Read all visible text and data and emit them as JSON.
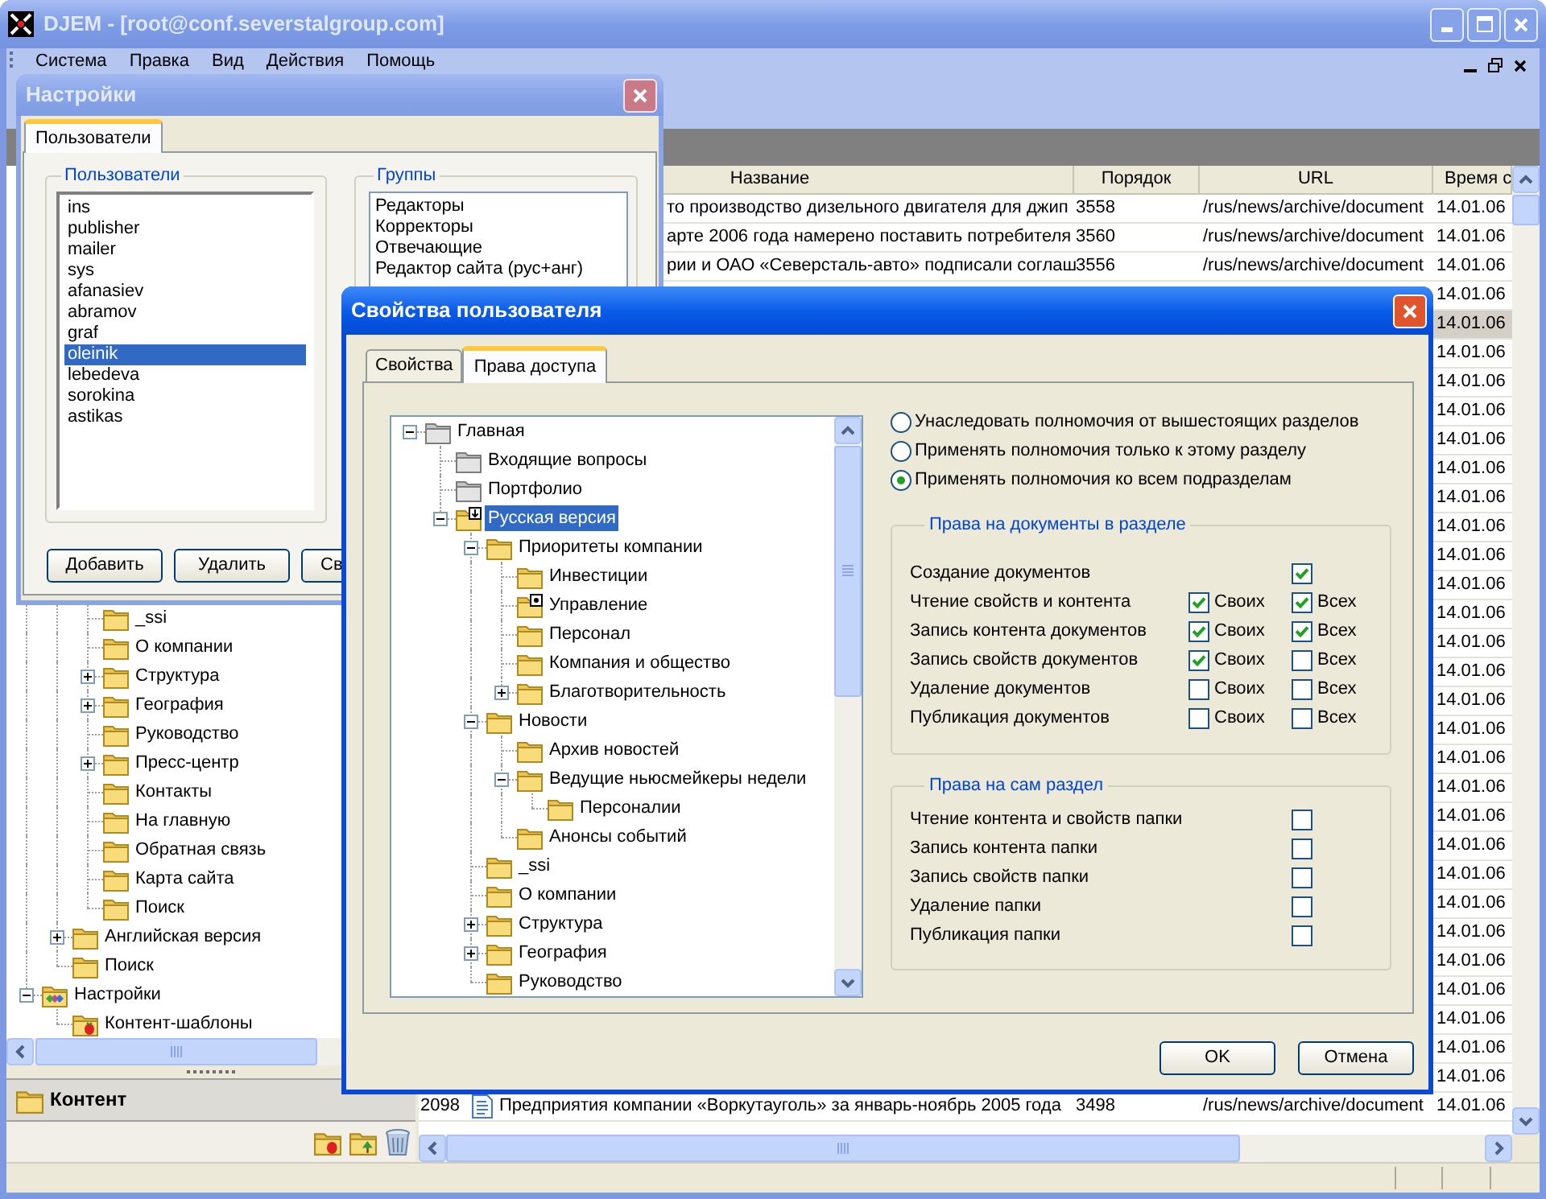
{
  "main_window": {
    "title": "DJEM - [root@conf.severstalgroup.com]",
    "menu": [
      "Система",
      "Правка",
      "Вид",
      "Действия",
      "Помощь"
    ]
  },
  "settings_dialog": {
    "title": "Настройки",
    "tabs": [
      {
        "label": "Пользователи",
        "selected": true
      }
    ],
    "users": {
      "title": "Пользователи",
      "items": [
        {
          "label": "ins",
          "selected": false
        },
        {
          "label": "publisher",
          "selected": false
        },
        {
          "label": "mailer",
          "selected": false
        },
        {
          "label": "sys",
          "selected": false
        },
        {
          "label": "afanasiev",
          "selected": false
        },
        {
          "label": "abramov",
          "selected": false
        },
        {
          "label": "graf",
          "selected": false
        },
        {
          "label": "oleinik",
          "selected": true
        },
        {
          "label": "lebedeva",
          "selected": false
        },
        {
          "label": "sorokina",
          "selected": false
        },
        {
          "label": "astikas",
          "selected": false
        }
      ]
    },
    "groups": {
      "title": "Группы",
      "items": [
        {
          "label": "Редакторы",
          "selected": false
        },
        {
          "label": "Корректоры",
          "selected": false
        },
        {
          "label": "Отвечающие",
          "selected": false
        },
        {
          "label": "Редактор сайта (рус+анг)",
          "selected": false
        }
      ]
    },
    "buttons": [
      "Добавить",
      "Удалить",
      "Св"
    ]
  },
  "left_panel": {
    "tree": [
      {
        "children": [
          {
            "children": [
              {
                "label": "_ssi",
                "kind": "plain",
                "selected": false
              },
              {
                "label": "О компании",
                "kind": "plain",
                "selected": false
              },
              {
                "label": "Структура",
                "kind": "plain",
                "expanded": false,
                "selected": false
              },
              {
                "label": "География",
                "kind": "plain",
                "expanded": false,
                "selected": false
              },
              {
                "label": "Руководство",
                "kind": "plain",
                "selected": false
              },
              {
                "label": "Пресс-центр",
                "kind": "plain",
                "expanded": false,
                "selected": false
              },
              {
                "label": "Контакты",
                "kind": "plain",
                "selected": false
              },
              {
                "label": "На главную",
                "kind": "plain",
                "selected": false
              },
              {
                "label": "Обратная связь",
                "kind": "plain",
                "selected": false
              },
              {
                "label": "Карта сайта",
                "kind": "plain",
                "selected": false
              },
              {
                "label": "Поиск",
                "kind": "plain",
                "selected": false
              }
            ]
          },
          {
            "label": "Английская версия",
            "kind": "plain",
            "expanded": false,
            "selected": false
          },
          {
            "label": "Поиск",
            "kind": "plain",
            "selected": false
          }
        ]
      },
      {
        "label": "Настройки",
        "kind": "settings",
        "expanded": true,
        "selected": false,
        "children": [
          {
            "label": "Контент-шаблоны",
            "kind": "templates",
            "selected": false
          }
        ]
      }
    ],
    "panel_title": "Контент"
  },
  "table": {
    "columns": [
      "Название",
      "Порядок",
      "URL",
      "Время с"
    ],
    "rows": [
      {
        "title": "то производство дизельного двигателя для джип",
        "order": "3558",
        "url": "/rus/news/archive/document",
        "time": "14.01.06",
        "selected": false
      },
      {
        "title": "арте 2006 года намерено поставить потребителя",
        "order": "3560",
        "url": "/rus/news/archive/document",
        "time": "14.01.06",
        "selected": false
      },
      {
        "title": "рии и ОАО «Северсталь-авто» подписали соглаш",
        "order": "3556",
        "url": "/rus/news/archive/document",
        "time": "14.01.06",
        "selected": false
      },
      {
        "time": "14.01.06",
        "selected": false
      },
      {
        "time": "14.01.06",
        "selected": true
      },
      {
        "time": "14.01.06",
        "selected": false
      },
      {
        "time": "14.01.06",
        "selected": false
      },
      {
        "time": "14.01.06",
        "selected": false
      },
      {
        "time": "14.01.06",
        "selected": false
      },
      {
        "time": "14.01.06",
        "selected": false
      },
      {
        "time": "14.01.06",
        "selected": false
      },
      {
        "time": "14.01.06",
        "selected": false
      },
      {
        "time": "14.01.06",
        "selected": false
      },
      {
        "time": "14.01.06",
        "selected": false
      },
      {
        "time": "14.01.06",
        "selected": false
      },
      {
        "time": "14.01.06",
        "selected": false
      },
      {
        "time": "14.01.06",
        "selected": false
      },
      {
        "time": "14.01.06",
        "selected": false
      },
      {
        "time": "14.01.06",
        "selected": false
      },
      {
        "time": "14.01.06",
        "selected": false
      },
      {
        "time": "14.01.06",
        "selected": false
      },
      {
        "time": "14.01.06",
        "selected": false
      },
      {
        "time": "14.01.06",
        "selected": false
      },
      {
        "time": "14.01.06",
        "selected": false
      },
      {
        "time": "14.01.06",
        "selected": false
      },
      {
        "time": "14.01.06",
        "selected": false
      },
      {
        "time": "14.01.06",
        "selected": false
      },
      {
        "time": "14.01.06",
        "selected": false
      },
      {
        "time": "14.01.06",
        "selected": false
      },
      {
        "time": "14.01.06",
        "selected": false
      },
      {
        "time": "14.01.06",
        "selected": false
      },
      {
        "number": "2098",
        "title": "Предприятия компании «Воркутауголь» за январь-ноябрь 2005 года",
        "order": "3498",
        "url": "/rus/news/archive/document",
        "time": "14.01.06",
        "selected": false
      }
    ]
  },
  "user_dialog": {
    "title": "Свойства пользователя",
    "tabs": [
      {
        "label": "Свойства",
        "selected": false
      },
      {
        "label": "Права доступа",
        "selected": true
      }
    ],
    "tree": [
      {
        "label": "Главная",
        "kind": "system",
        "expanded": true,
        "selected": false,
        "children": [
          {
            "label": "Входящие вопросы",
            "kind": "system",
            "selected": false
          },
          {
            "label": "Портфолио",
            "kind": "system",
            "selected": false
          },
          {
            "label": "Русская версия",
            "kind": "down",
            "expanded": true,
            "selected": true,
            "children": [
              {
                "label": "Приоритеты компании",
                "kind": "plain",
                "expanded": true,
                "selected": false,
                "children": [
                  {
                    "label": "Инвестиции",
                    "kind": "plain",
                    "selected": false
                  },
                  {
                    "label": "Управление",
                    "kind": "dot",
                    "selected": false
                  },
                  {
                    "label": "Персонал",
                    "kind": "plain",
                    "selected": false
                  },
                  {
                    "label": "Компания и общество",
                    "kind": "plain",
                    "selected": false
                  },
                  {
                    "label": "Благотворительность",
                    "kind": "plain",
                    "expanded": false,
                    "selected": false
                  }
                ]
              },
              {
                "label": "Новости",
                "kind": "plain",
                "expanded": true,
                "selected": false,
                "children": [
                  {
                    "label": "Архив новостей",
                    "kind": "plain",
                    "selected": false
                  },
                  {
                    "label": "Ведущие ньюсмейкеры недели",
                    "kind": "plain",
                    "expanded": true,
                    "selected": false,
                    "children": [
                      {
                        "label": "Персоналии",
                        "kind": "plain",
                        "selected": false
                      }
                    ]
                  },
                  {
                    "label": "Анонсы событий",
                    "kind": "plain",
                    "selected": false
                  }
                ]
              },
              {
                "label": "_ssi",
                "kind": "plain",
                "selected": false
              },
              {
                "label": "О компании",
                "kind": "plain",
                "selected": false
              },
              {
                "label": "Структура",
                "kind": "plain",
                "expanded": false,
                "selected": false
              },
              {
                "label": "География",
                "kind": "plain",
                "expanded": false,
                "selected": false
              },
              {
                "label": "Руководство",
                "kind": "plain",
                "selected": false
              }
            ]
          }
        ]
      }
    ],
    "scope_options": [
      {
        "label": "Унаследовать полномочия от вышестоящих разделов",
        "selected": false
      },
      {
        "label": "Применять полномочия только к этому разделу",
        "selected": false
      },
      {
        "label": "Применять полномочия ко всем подразделам",
        "selected": true
      }
    ],
    "document_rights": {
      "title": "Права на документы в разделе",
      "rows": [
        {
          "label": "Создание документов",
          "all": {
            "checked": true
          }
        },
        {
          "label": "Чтение свойств и контента",
          "own": {
            "label": "Своих",
            "checked": true
          },
          "all": {
            "label": "Всех",
            "checked": true
          }
        },
        {
          "label": "Запись контента документов",
          "own": {
            "label": "Своих",
            "checked": true
          },
          "all": {
            "label": "Всех",
            "checked": true
          }
        },
        {
          "label": "Запись свойств документов",
          "own": {
            "label": "Своих",
            "checked": true
          },
          "all": {
            "label": "Всех",
            "checked": false
          }
        },
        {
          "label": "Удаление документов",
          "own": {
            "label": "Своих",
            "checked": false
          },
          "all": {
            "label": "Всех",
            "checked": false
          }
        },
        {
          "label": "Публикация документов",
          "own": {
            "label": "Своих",
            "checked": false
          },
          "all": {
            "label": "Всех",
            "checked": false
          }
        }
      ]
    },
    "section_rights": {
      "title": "Права на сам раздел",
      "rows": [
        {
          "label": "Чтение контента и свойств папки",
          "checked": false
        },
        {
          "label": "Запись контента папки",
          "checked": false
        },
        {
          "label": "Запись свойств папки",
          "checked": false
        },
        {
          "label": "Удаление папки",
          "checked": false
        },
        {
          "label": "Публикация папки",
          "checked": false
        }
      ]
    },
    "buttons": [
      "OK",
      "Отмена"
    ]
  }
}
